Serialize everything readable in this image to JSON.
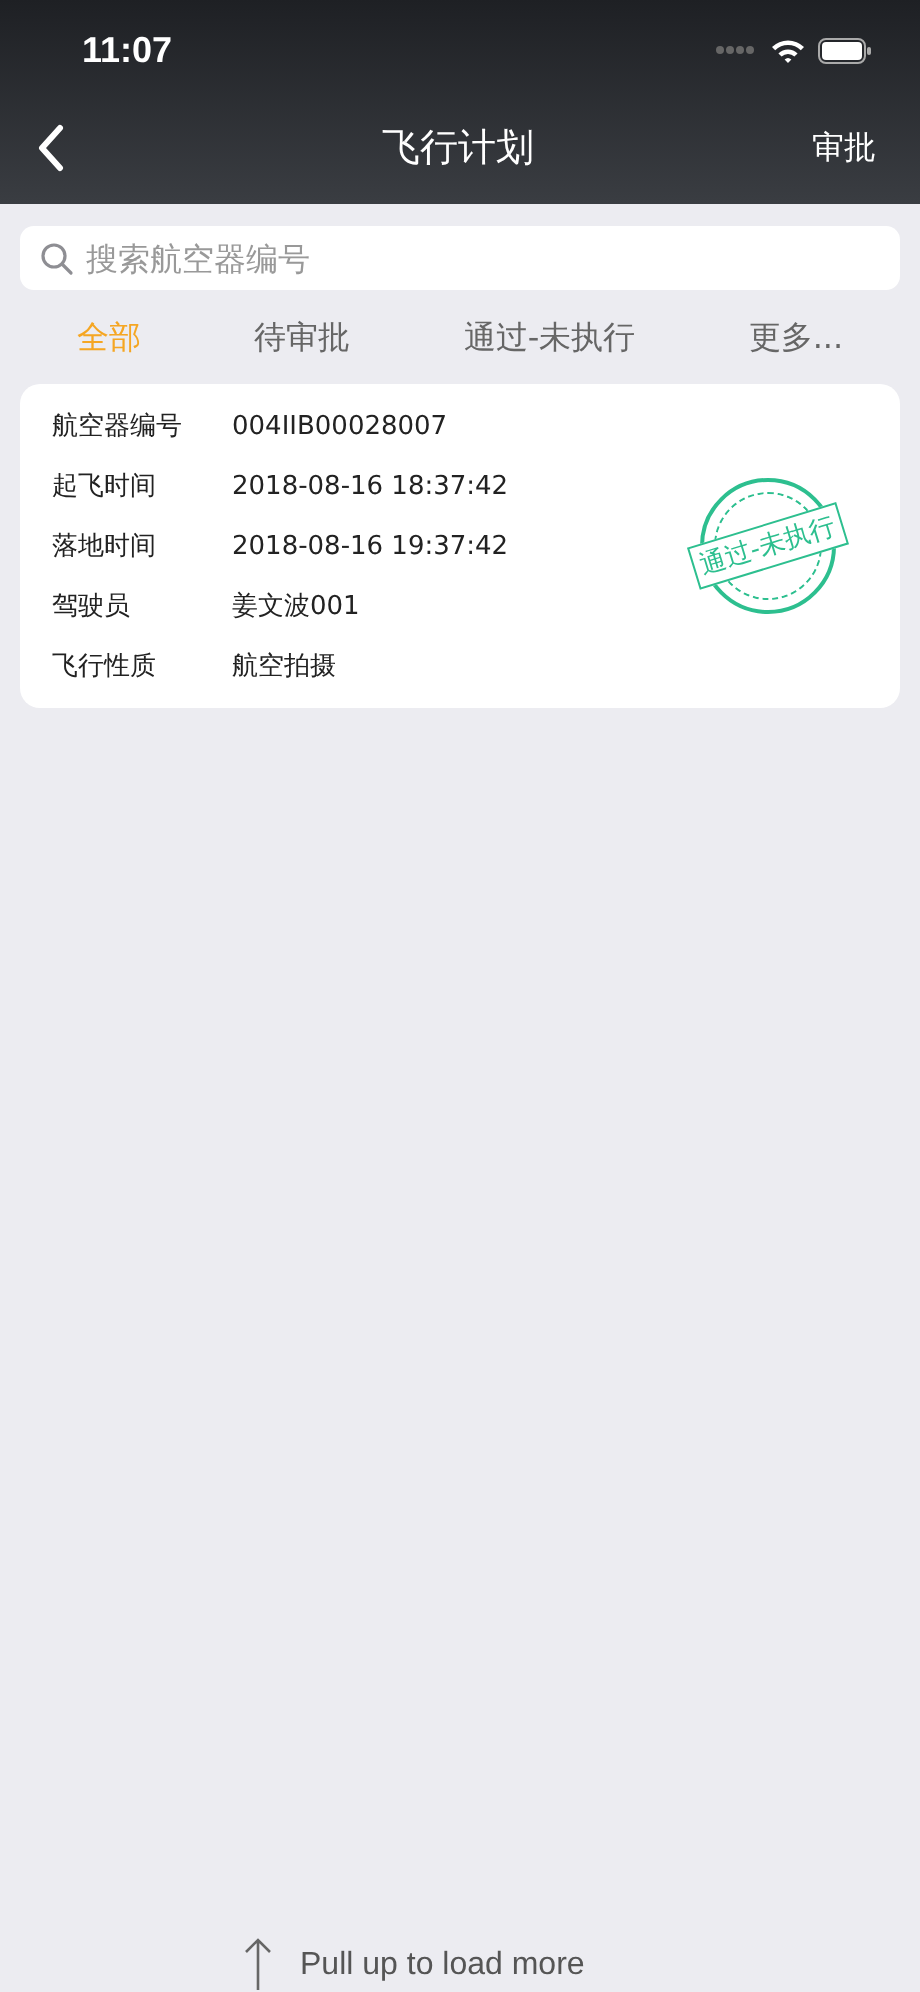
{
  "status_bar": {
    "time": "11:07"
  },
  "nav": {
    "title": "飞行计划",
    "action": "审批"
  },
  "search": {
    "placeholder": "搜索航空器编号"
  },
  "tabs": [
    {
      "label": "全部",
      "selected": true
    },
    {
      "label": "待审批",
      "selected": false
    },
    {
      "label": "通过-未执行",
      "selected": false
    },
    {
      "label": "更多...",
      "selected": false
    }
  ],
  "plans": [
    {
      "fields": [
        {
          "label": "航空器编号",
          "value": "004IIB00028007"
        },
        {
          "label": "起飞时间",
          "value": "2018-08-16 18:37:42"
        },
        {
          "label": "落地时间",
          "value": "2018-08-16 19:37:42"
        },
        {
          "label": "驾驶员",
          "value": "姜文波001"
        },
        {
          "label": "飞行性质",
          "value": "航空拍摄"
        }
      ],
      "stamp": {
        "text": "通过-未执行",
        "color": "#2dbf8f"
      }
    }
  ],
  "footer": {
    "text": "Pull up to load more"
  }
}
